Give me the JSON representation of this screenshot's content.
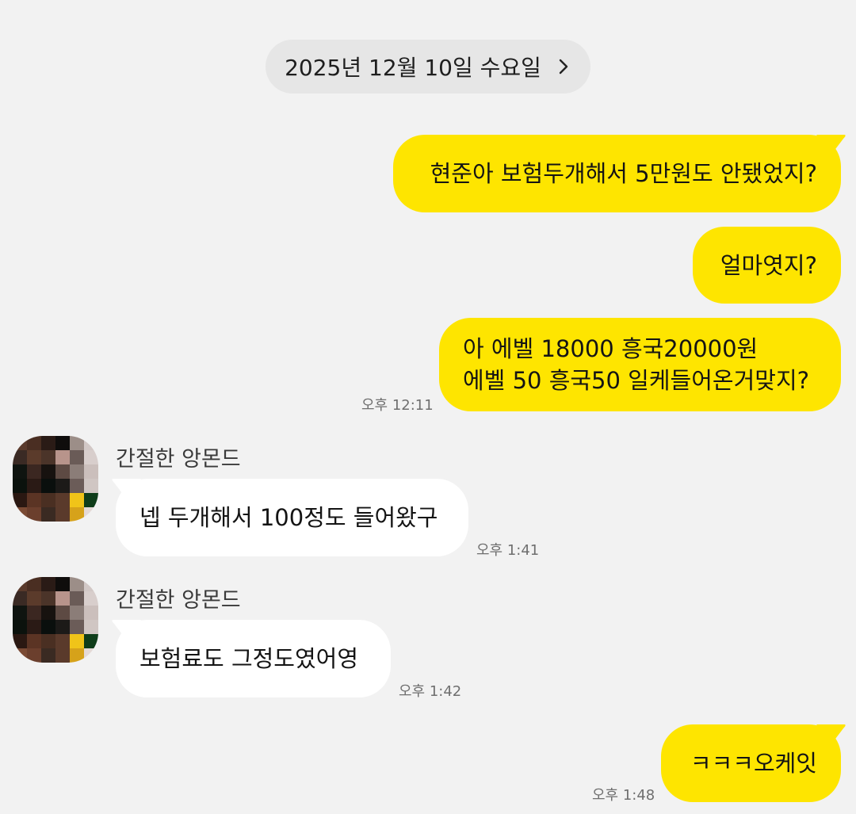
{
  "date_divider": {
    "label": "2025년 12월 10일 수요일",
    "icon": "chevron-right-icon"
  },
  "messages": [
    {
      "from": "me",
      "text": "현준아 보험두개해서 5만원도 안됐었지?"
    },
    {
      "from": "me",
      "text": "얼마엿지?"
    },
    {
      "from": "me",
      "lines": [
        "아 에벨 18000 흥국20000원",
        "에벨 50 흥국50 일케들어온거맞지?"
      ],
      "time": "오후 12:11"
    },
    {
      "from": "them",
      "sender": "간절한 앙몬드",
      "text": "넵 두개해서 100정도 들어왔구",
      "time": "오후 1:41"
    },
    {
      "from": "them",
      "sender": "간절한 앙몬드",
      "text": "보험료도 그정도였어영",
      "time": "오후 1:42"
    },
    {
      "from": "me",
      "text": "ㅋㅋㅋ오케잇",
      "time": "오후 1:48"
    }
  ],
  "colors": {
    "background": "#f2f2f2",
    "my_bubble": "#fee500",
    "their_bubble": "#ffffff",
    "date_pill": "#e6e6e6"
  }
}
